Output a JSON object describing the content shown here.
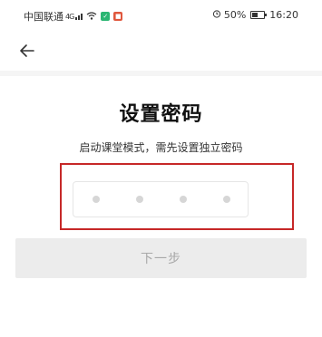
{
  "status_bar": {
    "carrier": "中国联通",
    "signal_label": "4G",
    "battery": "50%",
    "battery_level": 0.5,
    "time": "16:20",
    "icons": [
      "network-4g-icon",
      "signal-bars-icon",
      "wifi-icon",
      "green-app-badge-icon",
      "red-app-badge-icon",
      "alarm-icon",
      "battery-icon"
    ]
  },
  "nav": {
    "back_icon": "arrow-left-icon"
  },
  "page": {
    "title": "设置密码",
    "subtitle": "启动课堂模式，需先设置独立密码"
  },
  "pin": {
    "length": 4,
    "filled": 0
  },
  "actions": {
    "next_label": "下一步"
  },
  "colors": {
    "highlight_border": "#c62828",
    "dot_empty": "#d6d6d6",
    "button_disabled_bg": "#ececec",
    "button_disabled_text": "#a8a8a8"
  }
}
